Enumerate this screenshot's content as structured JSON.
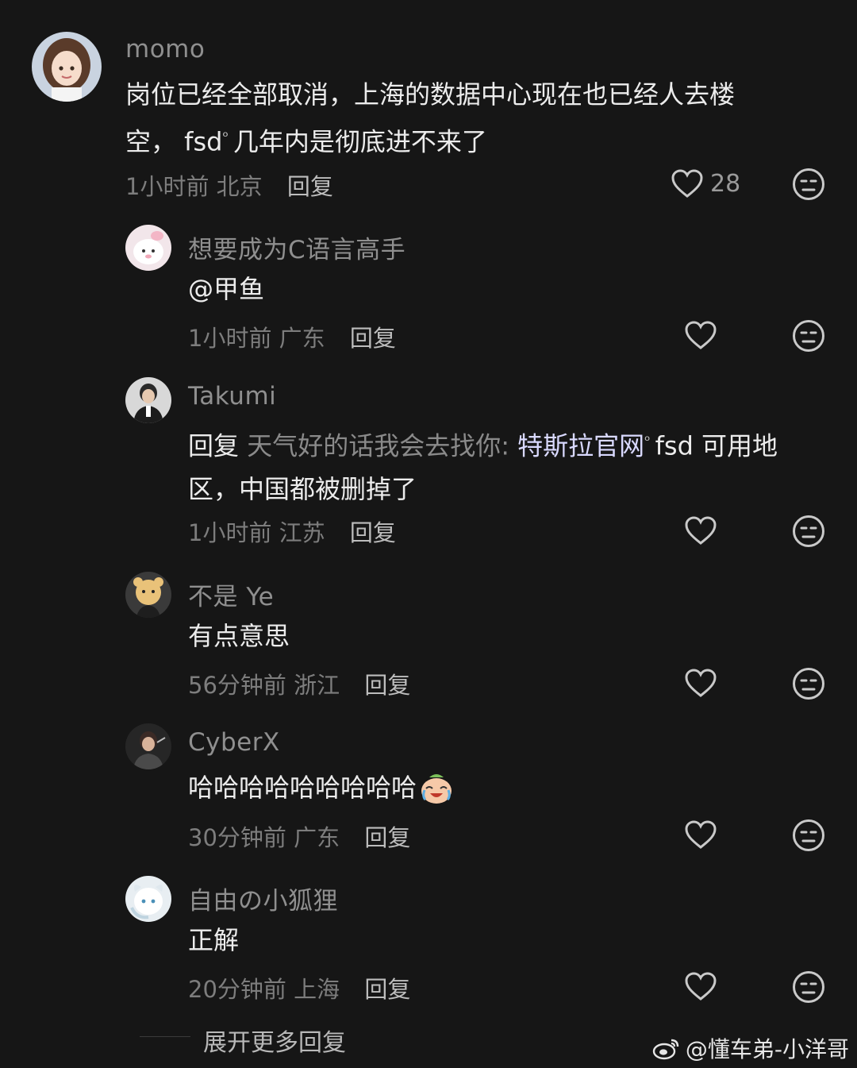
{
  "comments": [
    {
      "username": "momo",
      "text_line1": "岗位已经全部取消，上海的数据中心现在也已经人去楼",
      "text_line2_a": "空， fsd",
      "text_line2_b": "几年内是彻底进不来了",
      "time": "1小时前",
      "location": "北京",
      "reply_label": "回复",
      "likes": "28"
    },
    {
      "username": "想要成为C语言高手",
      "text": "@甲鱼",
      "time": "1小时前",
      "location": "广东",
      "reply_label": "回复"
    },
    {
      "username": "Takumi",
      "reply_prefix": "回复",
      "reply_to": "天气好的话我会去找你:",
      "text_line1_link": "特斯拉官网",
      "text_line1_b": "fsd 可用地",
      "text_line2": "区，中国都被删掉了",
      "time": "1小时前",
      "location": "江苏",
      "reply_label": "回复"
    },
    {
      "username": "不是 Ye",
      "text": "有点意思",
      "time": "56分钟前",
      "location": "浙江",
      "reply_label": "回复"
    },
    {
      "username": "CyberX",
      "text": "哈哈哈哈哈哈哈哈哈",
      "time": "30分钟前",
      "location": "广东",
      "reply_label": "回复"
    },
    {
      "username": "自由の小狐狸",
      "text": "正解",
      "time": "20分钟前",
      "location": "上海",
      "reply_label": "回复"
    }
  ],
  "expand_label": "展开更多回复",
  "watermark": "@懂车弟-小洋哥",
  "icons": {
    "like": "heart-icon",
    "dislike": "dislike-face-icon",
    "search": "search-mark-icon",
    "weibo": "weibo-logo-icon",
    "emoji": "laughing-crying-emoji-icon"
  }
}
